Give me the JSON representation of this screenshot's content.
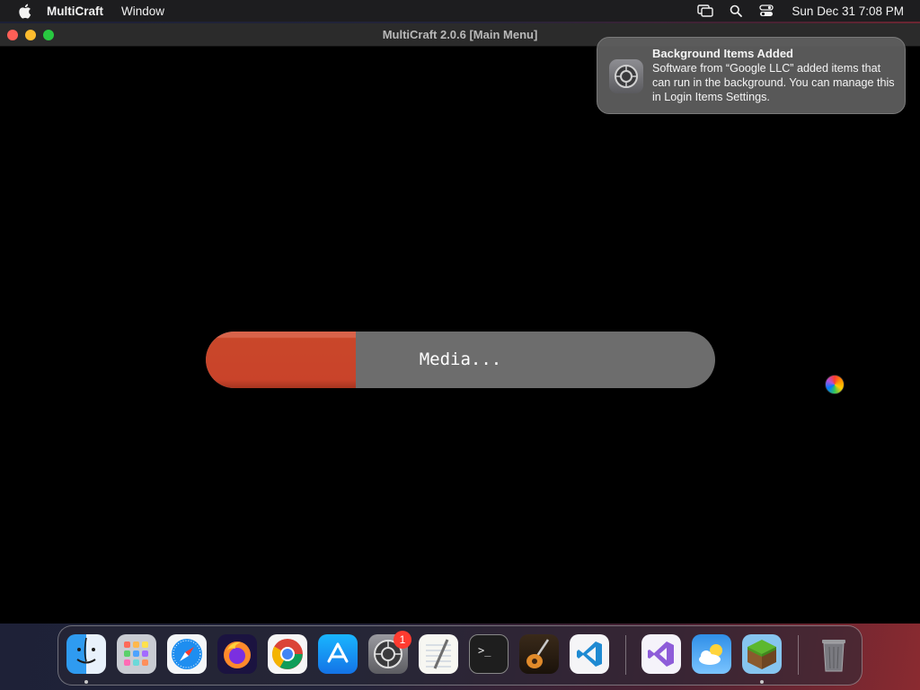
{
  "menubar": {
    "app_name": "MultiCraft",
    "menus": [
      "Window"
    ],
    "clock": "Sun Dec 31  7:08 PM"
  },
  "window": {
    "title": "MultiCraft 2.0.6 [Main Menu]"
  },
  "loading": {
    "label": "Media...",
    "progress": 0.295,
    "fill_color": "#c9452b",
    "track_color": "#6d6d6d"
  },
  "notification": {
    "title": "Background Items Added",
    "body": "Software from “Google LLC” added items that can run in the background. You can manage this in Login Items Settings."
  },
  "dock": {
    "apps": [
      {
        "name": "Finder",
        "icon": "finder-icon",
        "running": true
      },
      {
        "name": "Launchpad",
        "icon": "launchpad-icon",
        "running": false
      },
      {
        "name": "Safari",
        "icon": "safari-icon",
        "running": false
      },
      {
        "name": "Firefox",
        "icon": "firefox-icon",
        "running": false
      },
      {
        "name": "Google Chrome",
        "icon": "chrome-icon",
        "running": false
      },
      {
        "name": "App Store",
        "icon": "app-store-icon",
        "running": false
      },
      {
        "name": "System Settings",
        "icon": "system-settings-icon",
        "running": false,
        "badge": "1"
      },
      {
        "name": "TextEdit",
        "icon": "textedit-icon",
        "running": false
      },
      {
        "name": "Terminal",
        "icon": "terminal-icon",
        "running": false
      },
      {
        "name": "GarageBand",
        "icon": "garageband-icon",
        "running": false
      },
      {
        "name": "Visual Studio Code",
        "icon": "vscode-icon",
        "running": false
      },
      {
        "name": "Visual Studio",
        "icon": "visual-studio-icon",
        "running": false
      },
      {
        "name": "Weather",
        "icon": "weather-icon",
        "running": false
      },
      {
        "name": "MultiCraft",
        "icon": "multicraft-icon",
        "running": true
      },
      {
        "name": "Trash",
        "icon": "trash-icon",
        "running": false
      }
    ]
  }
}
